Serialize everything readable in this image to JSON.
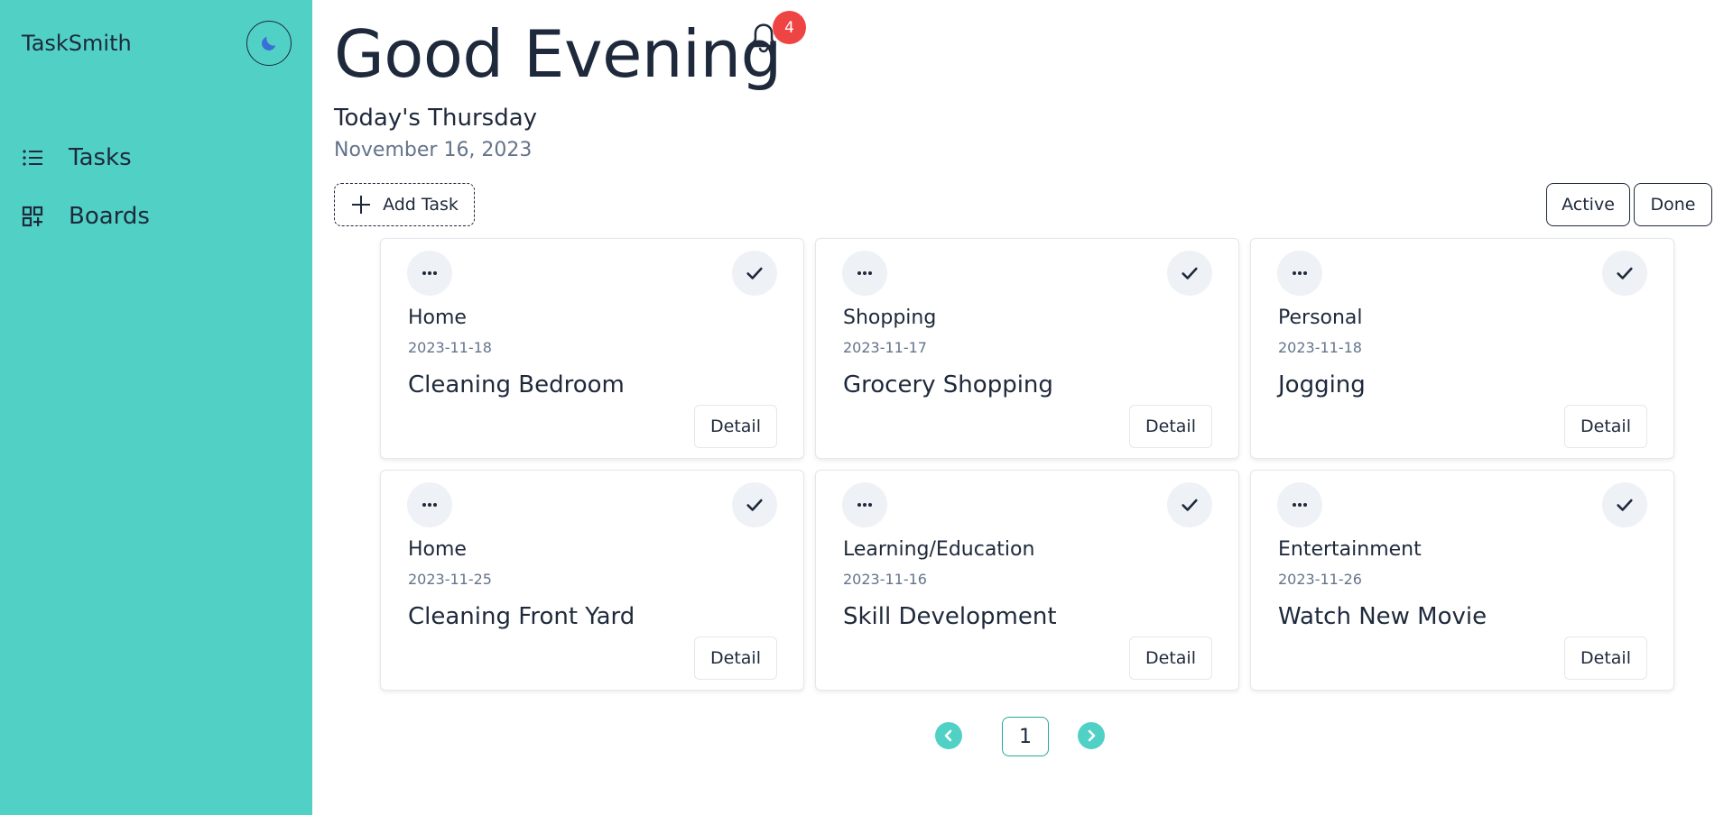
{
  "app": {
    "brand": "TaskSmith"
  },
  "sidebar": {
    "items": [
      {
        "label": "Tasks",
        "icon": "list-icon"
      },
      {
        "label": "Boards",
        "icon": "grid-plus-icon"
      }
    ]
  },
  "header": {
    "greeting": "Good Evening",
    "notification_count": "4",
    "day": "Today's Thursday",
    "date": "November 16, 2023"
  },
  "toolbar": {
    "add_task_label": "Add Task",
    "filters": [
      "Active",
      "Done"
    ]
  },
  "tasks": [
    {
      "category": "Home",
      "due": "2023-11-18",
      "title": "Cleaning Bedroom",
      "detail_label": "Detail"
    },
    {
      "category": "Shopping",
      "due": "2023-11-17",
      "title": "Grocery Shopping",
      "detail_label": "Detail"
    },
    {
      "category": "Personal",
      "due": "2023-11-18",
      "title": "Jogging",
      "detail_label": "Detail"
    },
    {
      "category": "Home",
      "due": "2023-11-25",
      "title": "Cleaning Front Yard",
      "detail_label": "Detail"
    },
    {
      "category": "Learning/Education",
      "due": "2023-11-16",
      "title": "Skill Development",
      "detail_label": "Detail"
    },
    {
      "category": "Entertainment",
      "due": "2023-11-26",
      "title": "Watch New Movie",
      "detail_label": "Detail"
    }
  ],
  "pagination": {
    "current_page": "1"
  },
  "colors": {
    "sidebar_bg": "#51d1c5",
    "notification_badge": "#ef4444",
    "text_primary": "#1e293b",
    "text_muted": "#64748b"
  }
}
